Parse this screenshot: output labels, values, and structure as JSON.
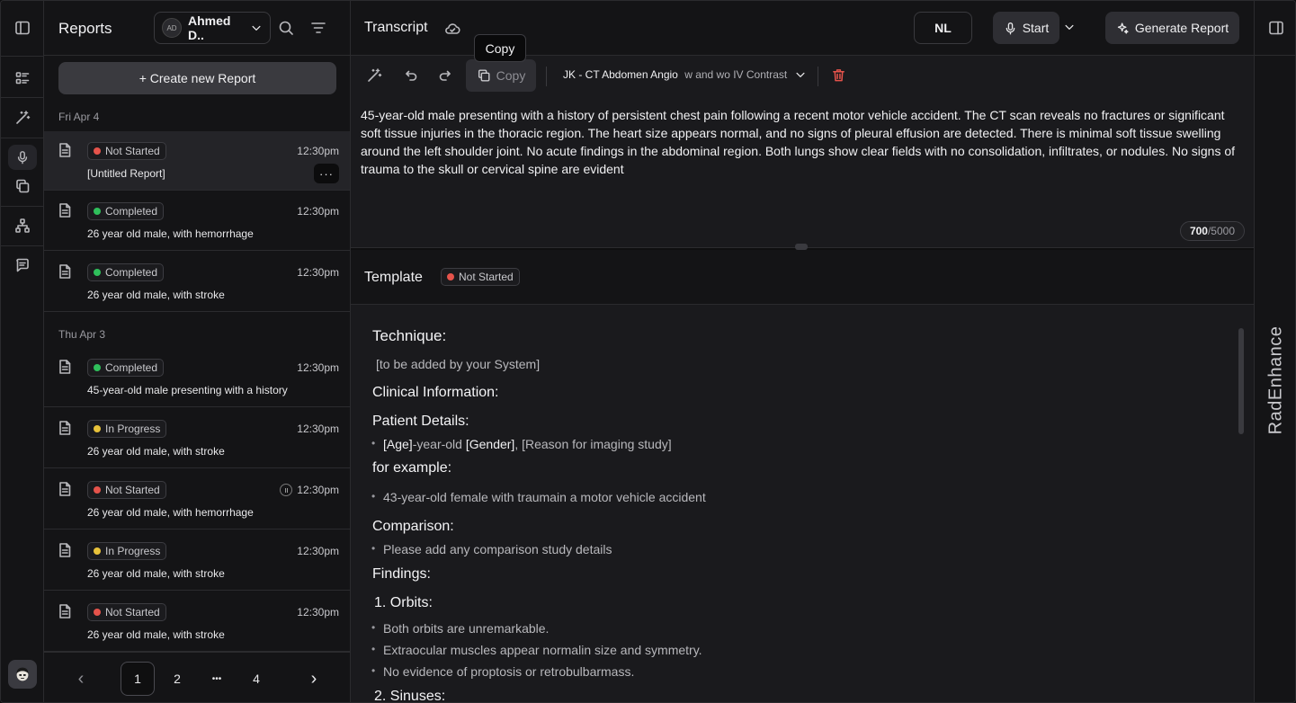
{
  "colors": {
    "red": "#e5534b",
    "green": "#2fbf5b",
    "yellow": "#e8c23a"
  },
  "reports": {
    "title": "Reports",
    "user": {
      "initials": "AD",
      "name": "Ahmed D.."
    },
    "create_label": "+ Create new Report",
    "groups": [
      {
        "date": "Fri Apr 4",
        "items": [
          {
            "status": "Not Started",
            "status_color": "red",
            "time": "12:30pm",
            "title": "[Untitled Report]",
            "selected": true
          },
          {
            "status": "Completed",
            "status_color": "green",
            "time": "12:30pm",
            "title": "26 year old male, with hemorrhage"
          },
          {
            "status": "Completed",
            "status_color": "green",
            "time": "12:30pm",
            "title": "26 year old male, with stroke"
          }
        ]
      },
      {
        "date": "Thu Apr 3",
        "items": [
          {
            "status": "Completed",
            "status_color": "green",
            "time": "12:30pm",
            "title": "45-year-old male presenting with a history"
          },
          {
            "status": "In Progress",
            "status_color": "yellow",
            "time": "12:30pm",
            "title": "26 year old male, with stroke"
          },
          {
            "status": "Not Started",
            "status_color": "red",
            "time": "12:30pm",
            "title": "26 year old male, with hemorrhage",
            "paused": true
          },
          {
            "status": "In Progress",
            "status_color": "yellow",
            "time": "12:30pm",
            "title": "26 year old male, with stroke"
          },
          {
            "status": "Not Started",
            "status_color": "red",
            "time": "12:30pm",
            "title": "26 year old male, with stroke"
          }
        ]
      }
    ],
    "more_label": "···",
    "pager": {
      "prev": "‹",
      "pages": [
        "1",
        "2",
        "•••",
        "4"
      ],
      "current": "1",
      "next": "›"
    }
  },
  "topbar": {
    "title": "Transcript",
    "lang": "NL",
    "start_label": "Start",
    "generate_label": "Generate Report",
    "tooltip": "Copy"
  },
  "toolbar": {
    "copy_label": "Copy",
    "template_name": "JK - CT Abdomen Angio",
    "template_suffix": " w and wo IV Contrast"
  },
  "transcript": {
    "text": "45-year-old male presenting with a history of persistent chest pain following a recent motor vehicle accident. The CT scan reveals no fractures or significant soft tissue injuries in the thoracic region. The heart size appears normal, and no signs of pleural effusion are detected. There is minimal soft tissue swelling around the left shoulder joint. No acute findings in the abdominal region. Both lungs show clear fields with no consolidation, infiltrates, or nodules. No signs of trauma to the skull or cervical spine are evident",
    "count": "700",
    "max": "/5000"
  },
  "template": {
    "title": "Template",
    "status": "Not Started",
    "technique_h": "Technique:",
    "technique_v": "[to be added by your System]",
    "clinical_h": "Clinical Information:",
    "patient_h": "Patient Details:",
    "patient_age": "[Age]",
    "patient_mid": "-year-old ",
    "patient_gender": "[Gender]",
    "patient_reason": ", [Reason for imaging study]",
    "example_h": "for example:",
    "example_v": "43-year-old female with traumain a motor vehicle accident",
    "comparison_h": "Comparison:",
    "comparison_v": "Please add any comparison study details",
    "findings_h": "Findings:",
    "orbits_h": "1. Orbits:",
    "orbits": [
      "Both orbits are unremarkable.",
      "Extraocular muscles appear normalin size and symmetry.",
      "No evidence of proptosis or retrobulbarmass."
    ],
    "sinuses_h": "2. Sinuses:"
  },
  "brand": "RadEnhance",
  "icons": [
    "sidebar-toggle-icon",
    "list-icon",
    "magic-wand-icon",
    "mic-icon",
    "copy-icon",
    "hierarchy-icon",
    "chat-icon",
    "search-icon",
    "filter-icon",
    "document-icon",
    "cloud-icon",
    "undo-icon",
    "redo-icon",
    "trash-icon",
    "sparkle-icon",
    "chevron-down-icon"
  ]
}
